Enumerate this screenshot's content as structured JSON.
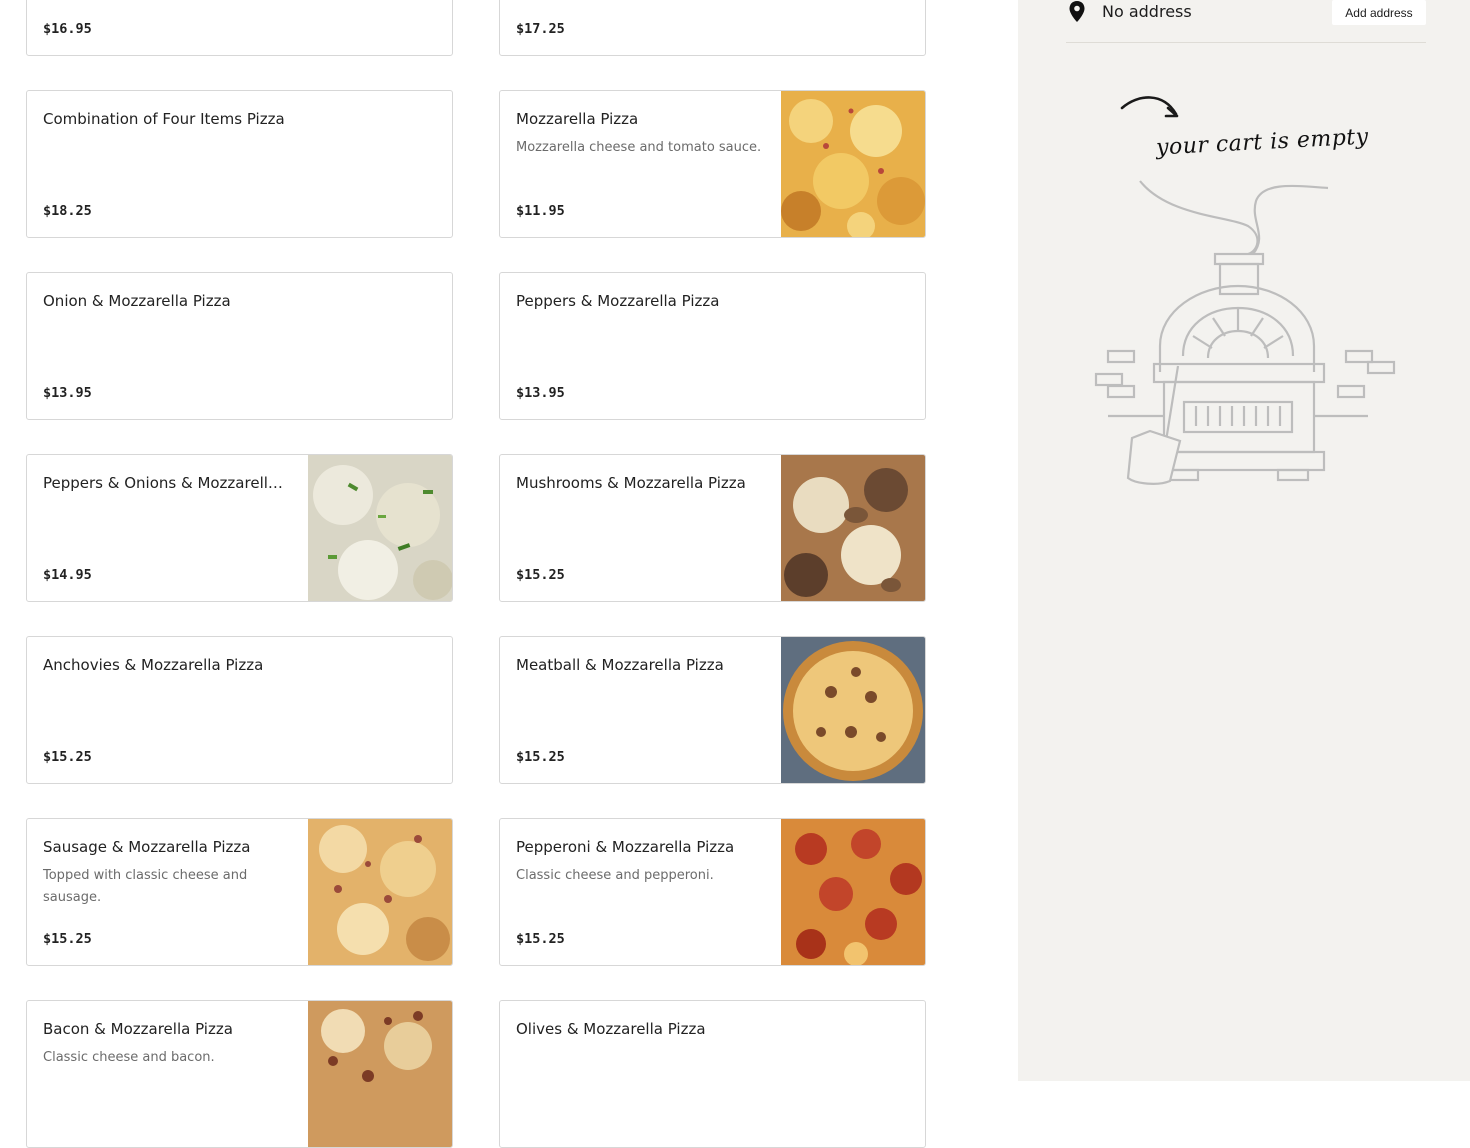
{
  "menu": {
    "items": [
      {
        "name": "",
        "description": "",
        "price": "$16.95"
      },
      {
        "name": "",
        "description": "",
        "price": "$17.25"
      },
      {
        "name": "Combination of Four Items Pizza",
        "description": "",
        "price": "$18.25"
      },
      {
        "name": "Mozzarella Pizza",
        "description": "Mozzarella cheese and tomato sauce.",
        "price": "$11.95"
      },
      {
        "name": "Onion & Mozzarella Pizza",
        "description": "",
        "price": "$13.95"
      },
      {
        "name": "Peppers & Mozzarella Pizza",
        "description": "",
        "price": "$13.95"
      },
      {
        "name": "Peppers & Onions & Mozzarella...",
        "description": "",
        "price": "$14.95"
      },
      {
        "name": "Mushrooms & Mozzarella Pizza",
        "description": "",
        "price": "$15.25"
      },
      {
        "name": "Anchovies & Mozzarella Pizza",
        "description": "",
        "price": "$15.25"
      },
      {
        "name": "Meatball & Mozzarella Pizza",
        "description": "",
        "price": "$15.25"
      },
      {
        "name": "Sausage & Mozzarella Pizza",
        "description": "Topped with classic cheese and sausage.",
        "price": "$15.25"
      },
      {
        "name": "Pepperoni & Mozzarella Pizza",
        "description": "Classic cheese and pepperoni.",
        "price": "$15.25"
      },
      {
        "name": "Bacon & Mozzarella Pizza",
        "description": "Classic cheese and bacon.",
        "price": ""
      },
      {
        "name": "Olives & Mozzarella Pizza",
        "description": "",
        "price": ""
      }
    ]
  },
  "sidebar": {
    "address_text": "No address",
    "add_address_label": "Add address",
    "cart_empty_text": "your cart is empty"
  },
  "icons": {
    "location": "map-pin-icon",
    "arrow": "curved-arrow-icon",
    "oven": "pizza-oven-illustration"
  },
  "colors": {
    "sidebar_bg": "#f3f2ef",
    "card_border": "#d7d7d7",
    "text_muted": "#6b6b6b"
  }
}
